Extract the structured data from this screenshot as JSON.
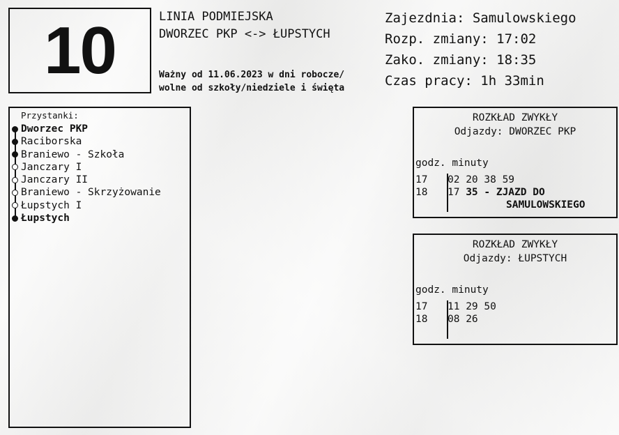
{
  "line": {
    "number": "10"
  },
  "route": {
    "type": "LINIA PODMIEJSKA",
    "name": "DWORZEC PKP <-> ŁUPSTYCH",
    "validity_line1": "Ważny od 11.06.2023 w dni robocze/",
    "validity_line2": "wolne od szkoły/niedziele i święta"
  },
  "depot": {
    "depot": "Zajezdnia: Samulowskiego",
    "shift_start": "Rozp. zmiany: 17:02",
    "shift_end": "Zako. zmiany: 18:35",
    "work_time": "Czas pracy: 1h 33min"
  },
  "stops": {
    "caption": "Przystanki:",
    "items": [
      {
        "label": "Dworzec PKP",
        "style": "bold"
      },
      {
        "label": "Raciborska",
        "style": "filled"
      },
      {
        "label": "Braniewo - Szkoła",
        "style": "filled"
      },
      {
        "label": "Janczary I",
        "style": "open"
      },
      {
        "label": "Janczary II",
        "style": "open"
      },
      {
        "label": "Braniewo - Skrzyżowanie",
        "style": "open"
      },
      {
        "label": "Łupstych I",
        "style": "open"
      },
      {
        "label": "Łupstych",
        "style": "bold"
      }
    ]
  },
  "timetables": [
    {
      "title": "ROZKŁAD ZWYKŁY",
      "direction": "Odjazdy: DWORZEC PKP",
      "header": "godz. minuty",
      "rows": [
        {
          "hour": "17",
          "minutes": "02 20 38 59"
        },
        {
          "hour": "18",
          "minutes": "17",
          "bold_tail": "35 - ZJAZD DO",
          "bold_tail2": "SAMULOWSKIEGO"
        }
      ]
    },
    {
      "title": "ROZKŁAD ZWYKŁY",
      "direction": "Odjazdy: ŁUPSTYCH",
      "header": "godz. minuty",
      "rows": [
        {
          "hour": "17",
          "minutes": "11 29 50"
        },
        {
          "hour": "18",
          "minutes": "08 26"
        }
      ]
    }
  ]
}
